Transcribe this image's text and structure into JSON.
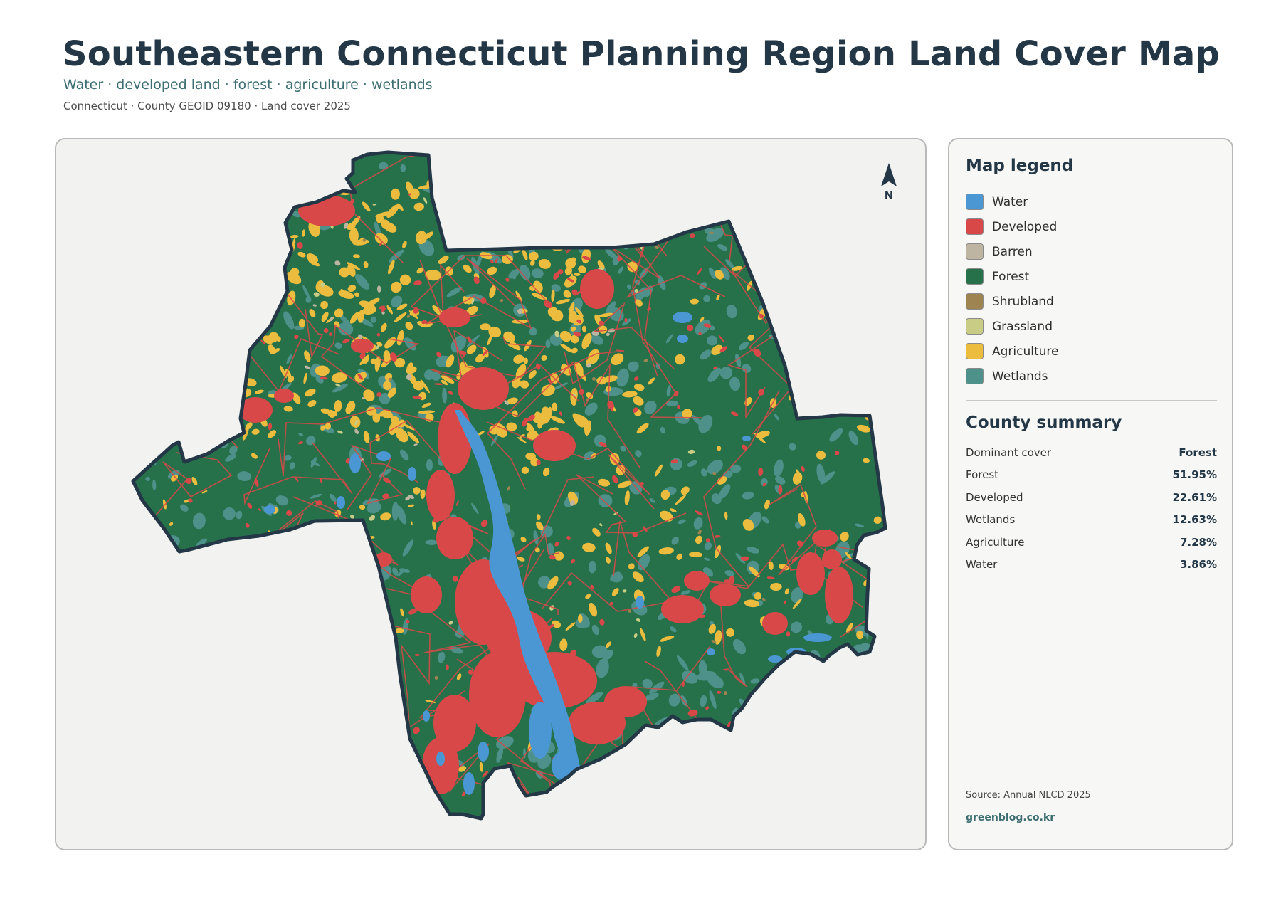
{
  "header": {
    "title": "Southeastern Connecticut Planning Region Land Cover Map",
    "subtitle": "Water · developed land · forest · agriculture · wetlands",
    "meta": "Connecticut · County GEOID 09180 · Land cover 2025"
  },
  "map": {
    "north_label": "N",
    "colors": {
      "background": "#f2f2f1",
      "outline": "#233746",
      "water": "#4a97d4",
      "developed": "#d94848",
      "barren": "#bdb5a2",
      "forest": "#27714a",
      "shrubland": "#9e8450",
      "grassland": "#c8cc84",
      "agriculture": "#ecbc3e",
      "wetlands": "#4e918a"
    }
  },
  "legend": {
    "title": "Map legend",
    "items": [
      {
        "label": "Water",
        "color": "#4a97d4"
      },
      {
        "label": "Developed",
        "color": "#d94848"
      },
      {
        "label": "Barren",
        "color": "#bdb5a2"
      },
      {
        "label": "Forest",
        "color": "#27714a"
      },
      {
        "label": "Shrubland",
        "color": "#9e8450"
      },
      {
        "label": "Grassland",
        "color": "#c8cc84"
      },
      {
        "label": "Agriculture",
        "color": "#ecbc3e"
      },
      {
        "label": "Wetlands",
        "color": "#4e918a"
      }
    ]
  },
  "summary": {
    "title": "County summary",
    "rows": [
      {
        "key": "Dominant cover",
        "value": "Forest"
      },
      {
        "key": "Forest",
        "value": "51.95%"
      },
      {
        "key": "Developed",
        "value": "22.61%"
      },
      {
        "key": "Wetlands",
        "value": "12.63%"
      },
      {
        "key": "Agriculture",
        "value": "7.28%"
      },
      {
        "key": "Water",
        "value": "3.86%"
      }
    ]
  },
  "footer": {
    "source": "Source: Annual NLCD 2025",
    "credit": "greenblog.co.kr"
  }
}
